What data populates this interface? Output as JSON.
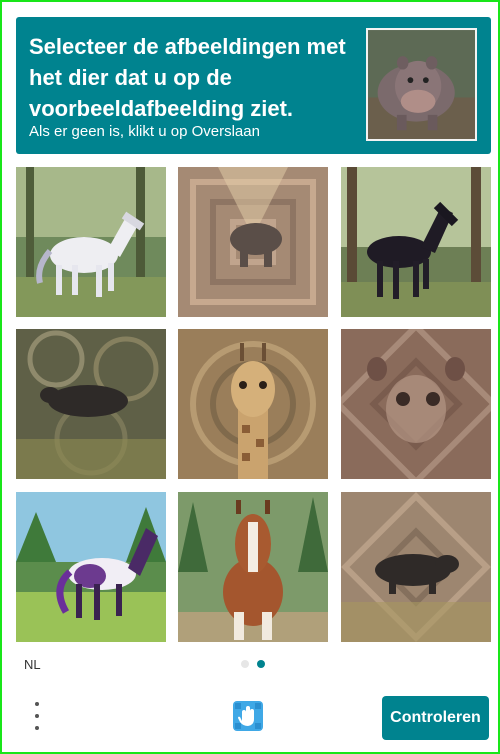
{
  "header": {
    "title": "Selecteer de afbeeldingen met het dier dat u op de voorbeeldafbeelding ziet.",
    "subtitle": "Als er geen is, klikt u op Overslaan"
  },
  "grid": {
    "tiles": [
      {
        "name": "tile-1-white-horse",
        "bg": "#6f8a5c"
      },
      {
        "name": "tile-2-distorted-shadow",
        "bg": "#a58a74"
      },
      {
        "name": "tile-3-black-horse",
        "bg": "#6d7f55"
      },
      {
        "name": "tile-4-distorted-hippo",
        "bg": "#5f6047"
      },
      {
        "name": "tile-5-giraffe",
        "bg": "#9a7e5a"
      },
      {
        "name": "tile-6-distorted-animal",
        "bg": "#8a6b5b"
      },
      {
        "name": "tile-7-purple-horse",
        "bg": "#5b8d4c"
      },
      {
        "name": "tile-8-brown-horse",
        "bg": "#7d9a6a"
      },
      {
        "name": "tile-9-distorted-hippo",
        "bg": "#9d8670"
      }
    ]
  },
  "footer": {
    "language": "NL",
    "page_dots": [
      {
        "active": false
      },
      {
        "active": true
      }
    ],
    "submit_label": "Controleren"
  },
  "colors": {
    "accent": "#00838f",
    "frame": "#19e619",
    "dot_inactive": "#e6e6e6",
    "dot_active": "#00838f"
  },
  "icons": {
    "menu": "vertical-dots-icon",
    "logo": "hcaptcha-hand-logo"
  }
}
